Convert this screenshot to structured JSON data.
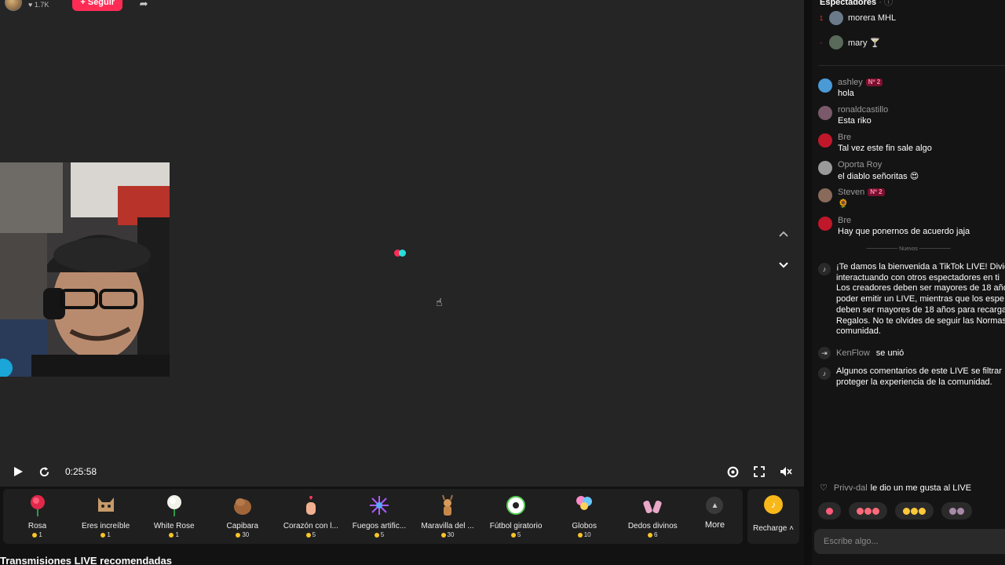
{
  "host": {
    "followers": "1.7K",
    "follow_label": "+ Seguir"
  },
  "player": {
    "time": "0:25:58"
  },
  "gifts": [
    {
      "name": "Rosa",
      "price": "1",
      "icon": "rose-icon"
    },
    {
      "name": "Eres increíble",
      "price": "1",
      "icon": "cat-icon"
    },
    {
      "name": "White Rose",
      "price": "1",
      "icon": "white-rose-icon"
    },
    {
      "name": "Capibara",
      "price": "30",
      "icon": "capybara-icon"
    },
    {
      "name": "Corazón con l...",
      "price": "5",
      "icon": "finger-heart-icon"
    },
    {
      "name": "Fuegos artific...",
      "price": "5",
      "icon": "fireworks-icon"
    },
    {
      "name": "Maravilla del ...",
      "price": "30",
      "icon": "deer-icon"
    },
    {
      "name": "Fútbol giratorio",
      "price": "5",
      "icon": "soccer-ball-icon"
    },
    {
      "name": "Globos",
      "price": "10",
      "icon": "balloons-icon"
    },
    {
      "name": "Dedos divinos",
      "price": "6",
      "icon": "hands-icon"
    }
  ],
  "more_label": "More",
  "recharge_label": "Recharge",
  "recommended_title": "Transmisiones LIVE recomendadas",
  "chat": {
    "spectators_title": "Espectadores",
    "viewers": [
      {
        "rank": "1",
        "name": "morera MHL"
      },
      {
        "rank": "-",
        "name": "mary 🍸"
      }
    ],
    "messages": [
      {
        "user": "ashley",
        "badge": "Nº 2",
        "text": "hola",
        "color": "#4a9ad6"
      },
      {
        "user": "ronaldcastillo",
        "badge": "",
        "text": "Esta riko",
        "color": "#7a5a6a"
      },
      {
        "user": "Bre",
        "badge": "",
        "text": "Tal vez este fin sale algo",
        "color": "#c0182a"
      },
      {
        "user": "Oporta Roy",
        "badge": "",
        "text": "el diablo señoritas 😍",
        "color": "#9a9a9a"
      },
      {
        "user": "Steven",
        "badge": "Nº 2",
        "text": "🌻",
        "color": "#8a6a5a"
      },
      {
        "user": "Bre",
        "badge": "",
        "text": "Hay que ponernos de acuerdo jaja",
        "color": "#c0182a"
      }
    ],
    "new_label": "Nuevos",
    "welcome_text": "¡Te damos la bienvenida a TikTok LIVE! Divie\ninteractuando con otros espectadores en ti\nLos creadores deben ser mayores de 18 año\npoder emitir un LIVE, mientras que los espe\ndeben ser mayores de 18 años para recarga\nRegalos. No te olvides de seguir las Normas\ncomunidad.",
    "join_user": "KenFlow",
    "join_text": "se unió",
    "filter_text": "Algunos comentarios de este LIVE se filtrar\nproteger la experiencia de la comunidad.",
    "like_user": "Privv-dal",
    "like_text": "le dio un me gusta al LIVE",
    "input_placeholder": "Escribe algo..."
  }
}
